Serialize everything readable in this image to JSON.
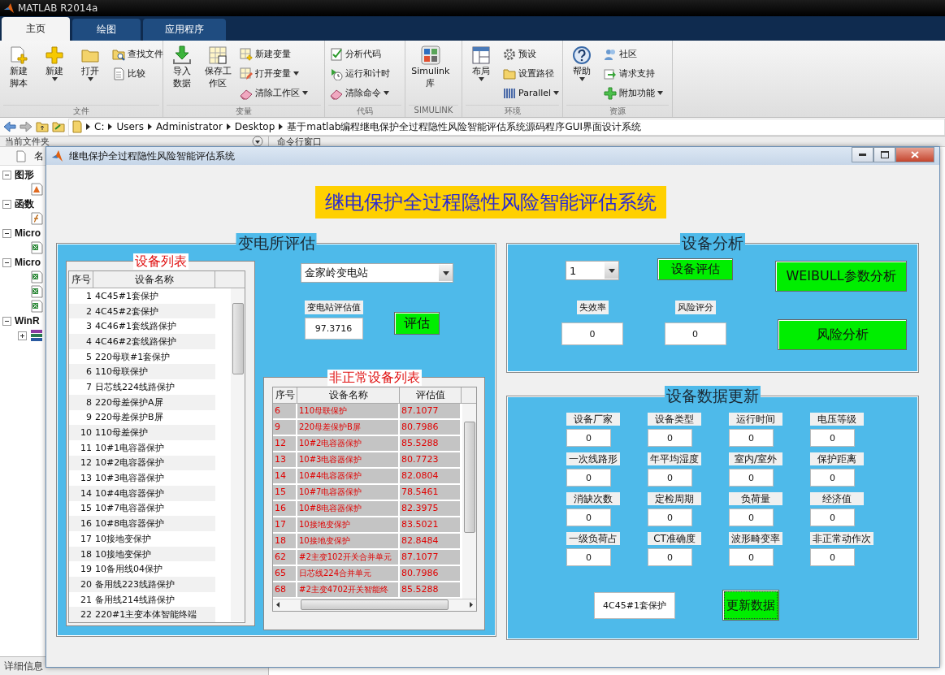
{
  "app": {
    "title": "MATLAB R2014a"
  },
  "tabs": [
    {
      "label": "主页",
      "selected": true
    },
    {
      "label": "绘图",
      "selected": false
    },
    {
      "label": "应用程序",
      "selected": false
    }
  ],
  "ribbon": {
    "groups": [
      {
        "label": "文件",
        "items": [
          {
            "label": "新建脚本",
            "kind": "large",
            "dropdown": false
          },
          {
            "label": "新建",
            "kind": "large",
            "dropdown": true
          },
          {
            "label": "打开",
            "kind": "large",
            "dropdown": true
          },
          {
            "label": "查找文件",
            "kind": "small",
            "dropdown": false
          },
          {
            "label": "比较",
            "kind": "small",
            "dropdown": false
          }
        ]
      },
      {
        "label": "变量",
        "items": [
          {
            "label": "导入数据",
            "kind": "large",
            "dropdown": false
          },
          {
            "label": "保存工作区",
            "kind": "large",
            "dropdown": false
          },
          {
            "label": "新建变量",
            "kind": "small",
            "dropdown": false
          },
          {
            "label": "打开变量",
            "kind": "small",
            "dropdown": true
          },
          {
            "label": "清除工作区",
            "kind": "small",
            "dropdown": true
          }
        ]
      },
      {
        "label": "代码",
        "items": [
          {
            "label": "分析代码",
            "kind": "small",
            "dropdown": false
          },
          {
            "label": "运行和计时",
            "kind": "small",
            "dropdown": false
          },
          {
            "label": "清除命令",
            "kind": "small",
            "dropdown": true
          }
        ]
      },
      {
        "label": "SIMULINK",
        "items": [
          {
            "label": "Simulink 库",
            "kind": "large",
            "dropdown": false
          }
        ]
      },
      {
        "label": "环境",
        "items": [
          {
            "label": "布局",
            "kind": "large",
            "dropdown": true
          },
          {
            "label": "预设",
            "kind": "small",
            "dropdown": false
          },
          {
            "label": "设置路径",
            "kind": "small",
            "dropdown": false
          },
          {
            "label": "Parallel",
            "kind": "small",
            "dropdown": true
          }
        ]
      },
      {
        "label": "资源",
        "items": [
          {
            "label": "帮助",
            "kind": "large",
            "dropdown": true
          },
          {
            "label": "社区",
            "kind": "small",
            "dropdown": false
          },
          {
            "label": "请求支持",
            "kind": "small",
            "dropdown": false
          },
          {
            "label": "附加功能",
            "kind": "small",
            "dropdown": true
          }
        ]
      }
    ]
  },
  "address_bar": {
    "crumbs": [
      "C:",
      "Users",
      "Administrator",
      "Desktop",
      "基于matlab编程继电保护全过程隐性风险智能评估系统源码程序GUI界面设计系统"
    ]
  },
  "current_folder": {
    "title": "当前文件夹",
    "column_1": "名",
    "sections": [
      {
        "label": "图形",
        "expanded": true,
        "children": [
          {
            "kind": "figure"
          }
        ]
      },
      {
        "label": "函数",
        "expanded": true,
        "children": [
          {
            "kind": "function"
          }
        ]
      },
      {
        "label": "Micro",
        "expanded": true,
        "children": [
          {
            "kind": "sheet"
          }
        ]
      },
      {
        "label": "Micro",
        "expanded": true,
        "children": [
          {
            "kind": "sheet"
          },
          {
            "kind": "sheet"
          },
          {
            "kind": "sheet"
          }
        ]
      },
      {
        "label": "WinR",
        "expanded": true,
        "children": [
          {
            "kind": "archive",
            "expanded": false
          }
        ]
      }
    ],
    "details": "详细信息"
  },
  "command_window": {
    "title": "命令行窗口"
  },
  "dialog": {
    "title": "继电保护全过程隐性风险智能评估系统",
    "heading": "继电保护全过程隐性风险智能评估系统",
    "substation_panel": {
      "title": "变电所评估",
      "device_list": {
        "title": "设备列表",
        "columns": [
          "序号",
          "设备名称"
        ],
        "rows": [
          [
            "1",
            "4C45#1套保护"
          ],
          [
            "2",
            "4C45#2套保护"
          ],
          [
            "3",
            "4C46#1套线路保护"
          ],
          [
            "4",
            "4C46#2套线路保护"
          ],
          [
            "5",
            "220母联#1套保护"
          ],
          [
            "6",
            "110母联保护"
          ],
          [
            "7",
            "日芯线224线路保护"
          ],
          [
            "8",
            "220母差保护A屏"
          ],
          [
            "9",
            "220母差保护B屏"
          ],
          [
            "10",
            "110母差保护"
          ],
          [
            "11",
            "10#1电容器保护"
          ],
          [
            "12",
            "10#2电容器保护"
          ],
          [
            "13",
            "10#3电容器保护"
          ],
          [
            "14",
            "10#4电容器保护"
          ],
          [
            "15",
            "10#7电容器保护"
          ],
          [
            "16",
            "10#8电容器保护"
          ],
          [
            "17",
            "10接地变保护"
          ],
          [
            "18",
            "10接地变保护"
          ],
          [
            "19",
            "10备用线04保护"
          ],
          [
            "20",
            "备用线223线路保护"
          ],
          [
            "21",
            "备用线214线路保护"
          ],
          [
            "22",
            "220#1主变本体智能终端"
          ]
        ]
      },
      "station_select": "金家岭变电站",
      "score_label": "变电站评估值",
      "score": "97.3716",
      "evaluate_button": "评估",
      "abnormal_list": {
        "title": "非正常设备列表",
        "columns": [
          "序号",
          "设备名称",
          "评估值"
        ],
        "rows": [
          [
            "6",
            "110母联保护",
            "87.1077"
          ],
          [
            "9",
            "220母差保护B屏",
            "80.7986"
          ],
          [
            "12",
            "10#2电容器保护",
            "85.5288"
          ],
          [
            "13",
            "10#3电容器保护",
            "80.7723"
          ],
          [
            "14",
            "10#4电容器保护",
            "82.0804"
          ],
          [
            "15",
            "10#7电容器保护",
            "78.5461"
          ],
          [
            "16",
            "10#8电容器保护",
            "82.3975"
          ],
          [
            "17",
            "10接地变保护",
            "83.5021"
          ],
          [
            "18",
            "10接地变保护",
            "82.8484"
          ],
          [
            "62",
            "#2主变102开关合并单元",
            "87.1077"
          ],
          [
            "65",
            "日芯线224合并单元",
            "80.7986"
          ],
          [
            "68",
            "#2主变4702开关智能终",
            "85.5288"
          ]
        ]
      }
    },
    "analysis_panel": {
      "title": "设备分析",
      "select": "1",
      "evaluate_button": "设备评估",
      "weibull_button": "WEIBULL参数分析",
      "risk_button": "风险分析",
      "fields": [
        {
          "label": "失效率",
          "value": "0"
        },
        {
          "label": "风险评分",
          "value": "0"
        }
      ]
    },
    "update_panel": {
      "title": "设备数据更新",
      "fields": [
        {
          "label": "设备厂家",
          "value": "0"
        },
        {
          "label": "设备类型",
          "value": "0"
        },
        {
          "label": "运行时间",
          "value": "0"
        },
        {
          "label": "电压等级",
          "value": "0"
        },
        {
          "label": "一次线路形",
          "value": "0"
        },
        {
          "label": "年平均湿度",
          "value": "0"
        },
        {
          "label": "室内/室外",
          "value": "0"
        },
        {
          "label": "保护距离",
          "value": "0"
        },
        {
          "label": "消缺次数",
          "value": "0"
        },
        {
          "label": "定检周期",
          "value": "0"
        },
        {
          "label": "负荷量",
          "value": "0"
        },
        {
          "label": "经济值",
          "value": "0"
        },
        {
          "label": "一级负荷占",
          "value": "0"
        },
        {
          "label": "CT准确度",
          "value": "0"
        },
        {
          "label": "波形畸变率",
          "value": "0"
        },
        {
          "label": "非正常动作次",
          "value": "0"
        }
      ],
      "device_name": "4C45#1套保护",
      "update_button": {
        "label": "更新数据",
        "focused": true
      }
    }
  }
}
